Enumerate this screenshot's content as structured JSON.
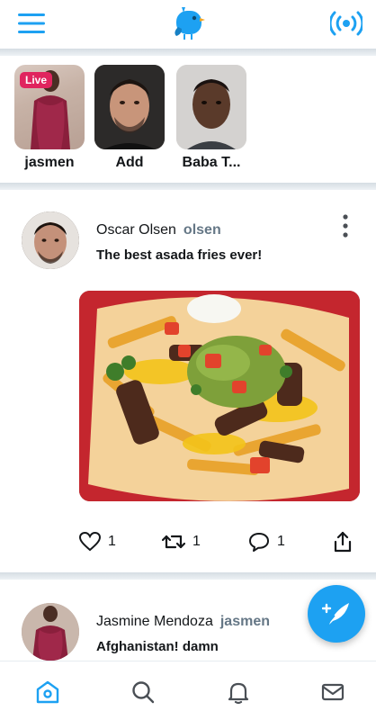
{
  "colors": {
    "accent": "#1da1f2",
    "live_badge": "#e0245e",
    "handle": "#657786"
  },
  "topbar": {
    "menu_icon": "hamburger-menu-icon",
    "logo_icon": "bird-logo-icon",
    "live_icon": "broadcast-icon"
  },
  "stories": [
    {
      "label": "jasmen",
      "badge": "Live"
    },
    {
      "label": "Add"
    },
    {
      "label": "Baba T..."
    }
  ],
  "posts": [
    {
      "name": "Oscar Olsen",
      "handle": "olsen",
      "text": "The best asada fries ever!",
      "likes": "1",
      "retweets": "1",
      "replies": "1"
    },
    {
      "name": "Jasmine Mendoza",
      "handle": "jasmen",
      "text": "Afghanistan! damn"
    }
  ],
  "bottom_nav": [
    "home-icon",
    "search-icon",
    "bell-icon",
    "mail-icon"
  ]
}
